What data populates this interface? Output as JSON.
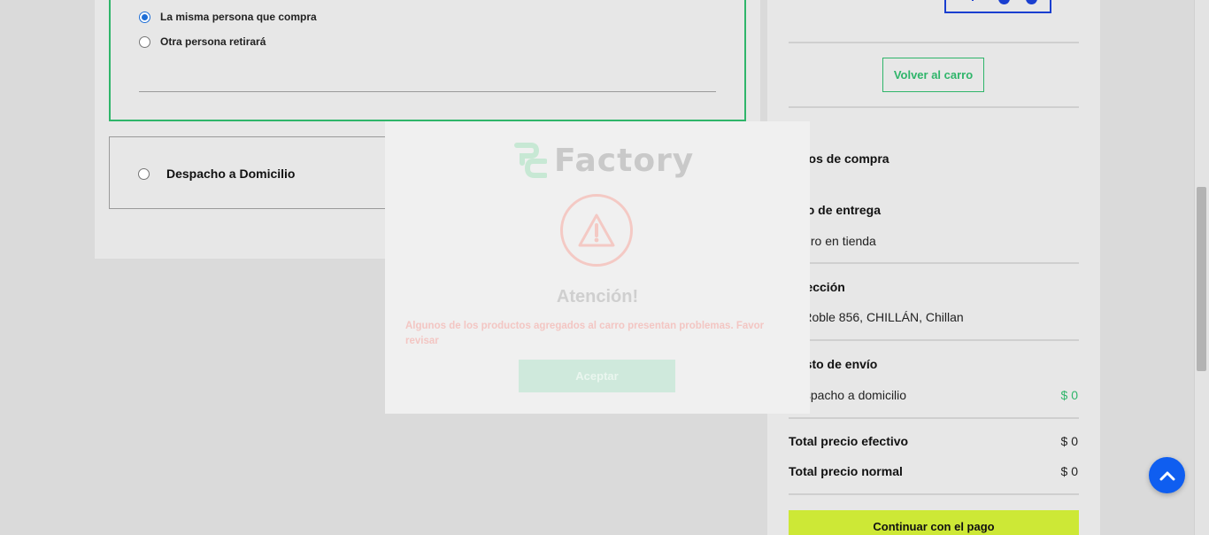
{
  "pickup": {
    "options": [
      {
        "label": "La misma persona que compra",
        "checked": true
      },
      {
        "label": "Otra persona retirará",
        "checked": false
      }
    ]
  },
  "delivery": {
    "label": "Despacho a Domicilio",
    "checked": false
  },
  "summary": {
    "back_button": "Volver al carro",
    "title": "Datos de compra",
    "delivery_type_label": "Tipo de entrega",
    "delivery_type_value": "Retiro en tienda",
    "address_label": "Dirección",
    "address_value": "El Roble 856, CHILLÁN, Chillan",
    "shipping_label": "Costo de envío",
    "shipping_item": "Despacho a domicilio",
    "shipping_value": "$ 0",
    "total_cash_label": "Total precio efectivo",
    "total_cash_value": "$ 0",
    "total_normal_label": "Total precio normal",
    "total_normal_value": "$ 0",
    "pay_button": "Continuar con el pago"
  },
  "modal": {
    "brand": "Factory",
    "title": "Atención!",
    "message": "Algunos de los productos agregados al carro presentan problemas. Favor revisar",
    "accept_button": "Aceptar"
  },
  "icons": {
    "warning": "warning-icon",
    "brand_logo": "factory-logo-icon",
    "scroll_top": "chevron-up-icon"
  },
  "colors": {
    "accent_green": "#2fb56a",
    "pay_button": "#cde836",
    "primary_blue": "#0f5ef0",
    "warning": "#f4c9c4"
  }
}
